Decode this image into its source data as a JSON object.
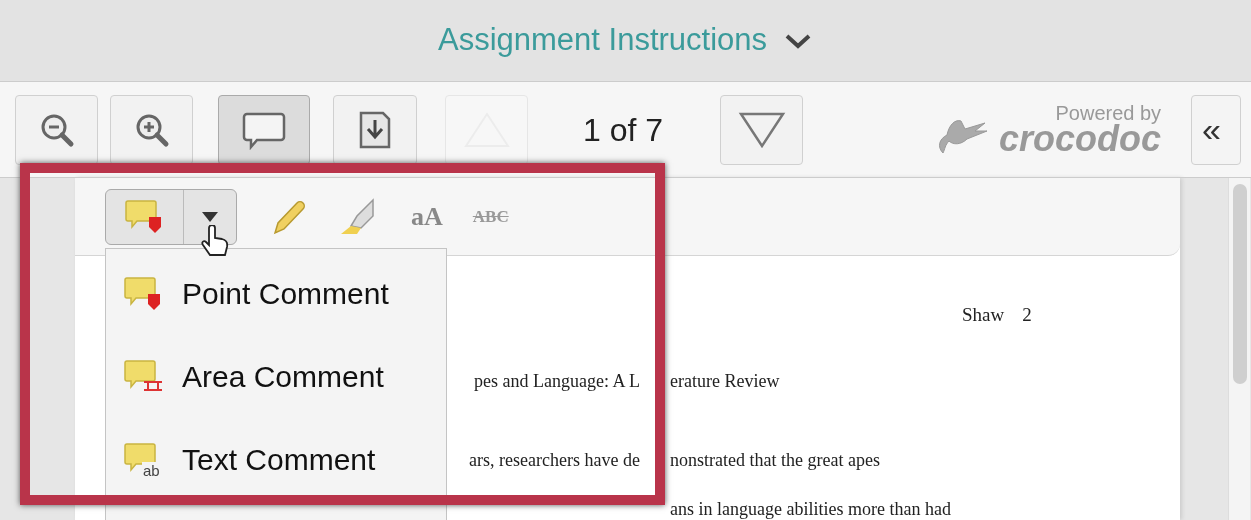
{
  "header": {
    "title": "Assignment Instructions"
  },
  "toolbar": {
    "buttons": [
      {
        "kind": "zoom-out",
        "selected": false,
        "disabled": false
      },
      {
        "kind": "zoom-in",
        "selected": false,
        "disabled": false
      },
      {
        "kind": "comment",
        "selected": true,
        "disabled": false
      },
      {
        "kind": "download",
        "selected": false,
        "disabled": false
      },
      {
        "kind": "prev",
        "selected": false,
        "disabled": true
      },
      {
        "kind": "next",
        "selected": false,
        "disabled": false
      }
    ],
    "page_indicator": "1 of 7",
    "branding": {
      "powered_by": "Powered by",
      "name": "crocodoc"
    },
    "panel_toggle": "«"
  },
  "annotation_tools": {
    "comment_split": {
      "expanded": true
    },
    "tools": [
      {
        "kind": "pencil"
      },
      {
        "kind": "highlighter"
      },
      {
        "kind": "text",
        "label": "aA"
      },
      {
        "kind": "strike",
        "label": "ABC"
      }
    ]
  },
  "comment_menu": [
    {
      "kind": "point",
      "label": "Point Comment"
    },
    {
      "kind": "area",
      "label": "Area Comment"
    },
    {
      "kind": "text",
      "label": "Text Comment",
      "icon_text": "ab"
    }
  ],
  "document": {
    "running_head": [
      "Shaw",
      "2"
    ],
    "lines": [
      {
        "left": "pes and Language: A L",
        "right": "erature Review"
      },
      {
        "left": "ars, researchers have de",
        "right": "nonstrated that the great apes"
      },
      {
        "right": "ans in language abilities more than had"
      }
    ]
  }
}
